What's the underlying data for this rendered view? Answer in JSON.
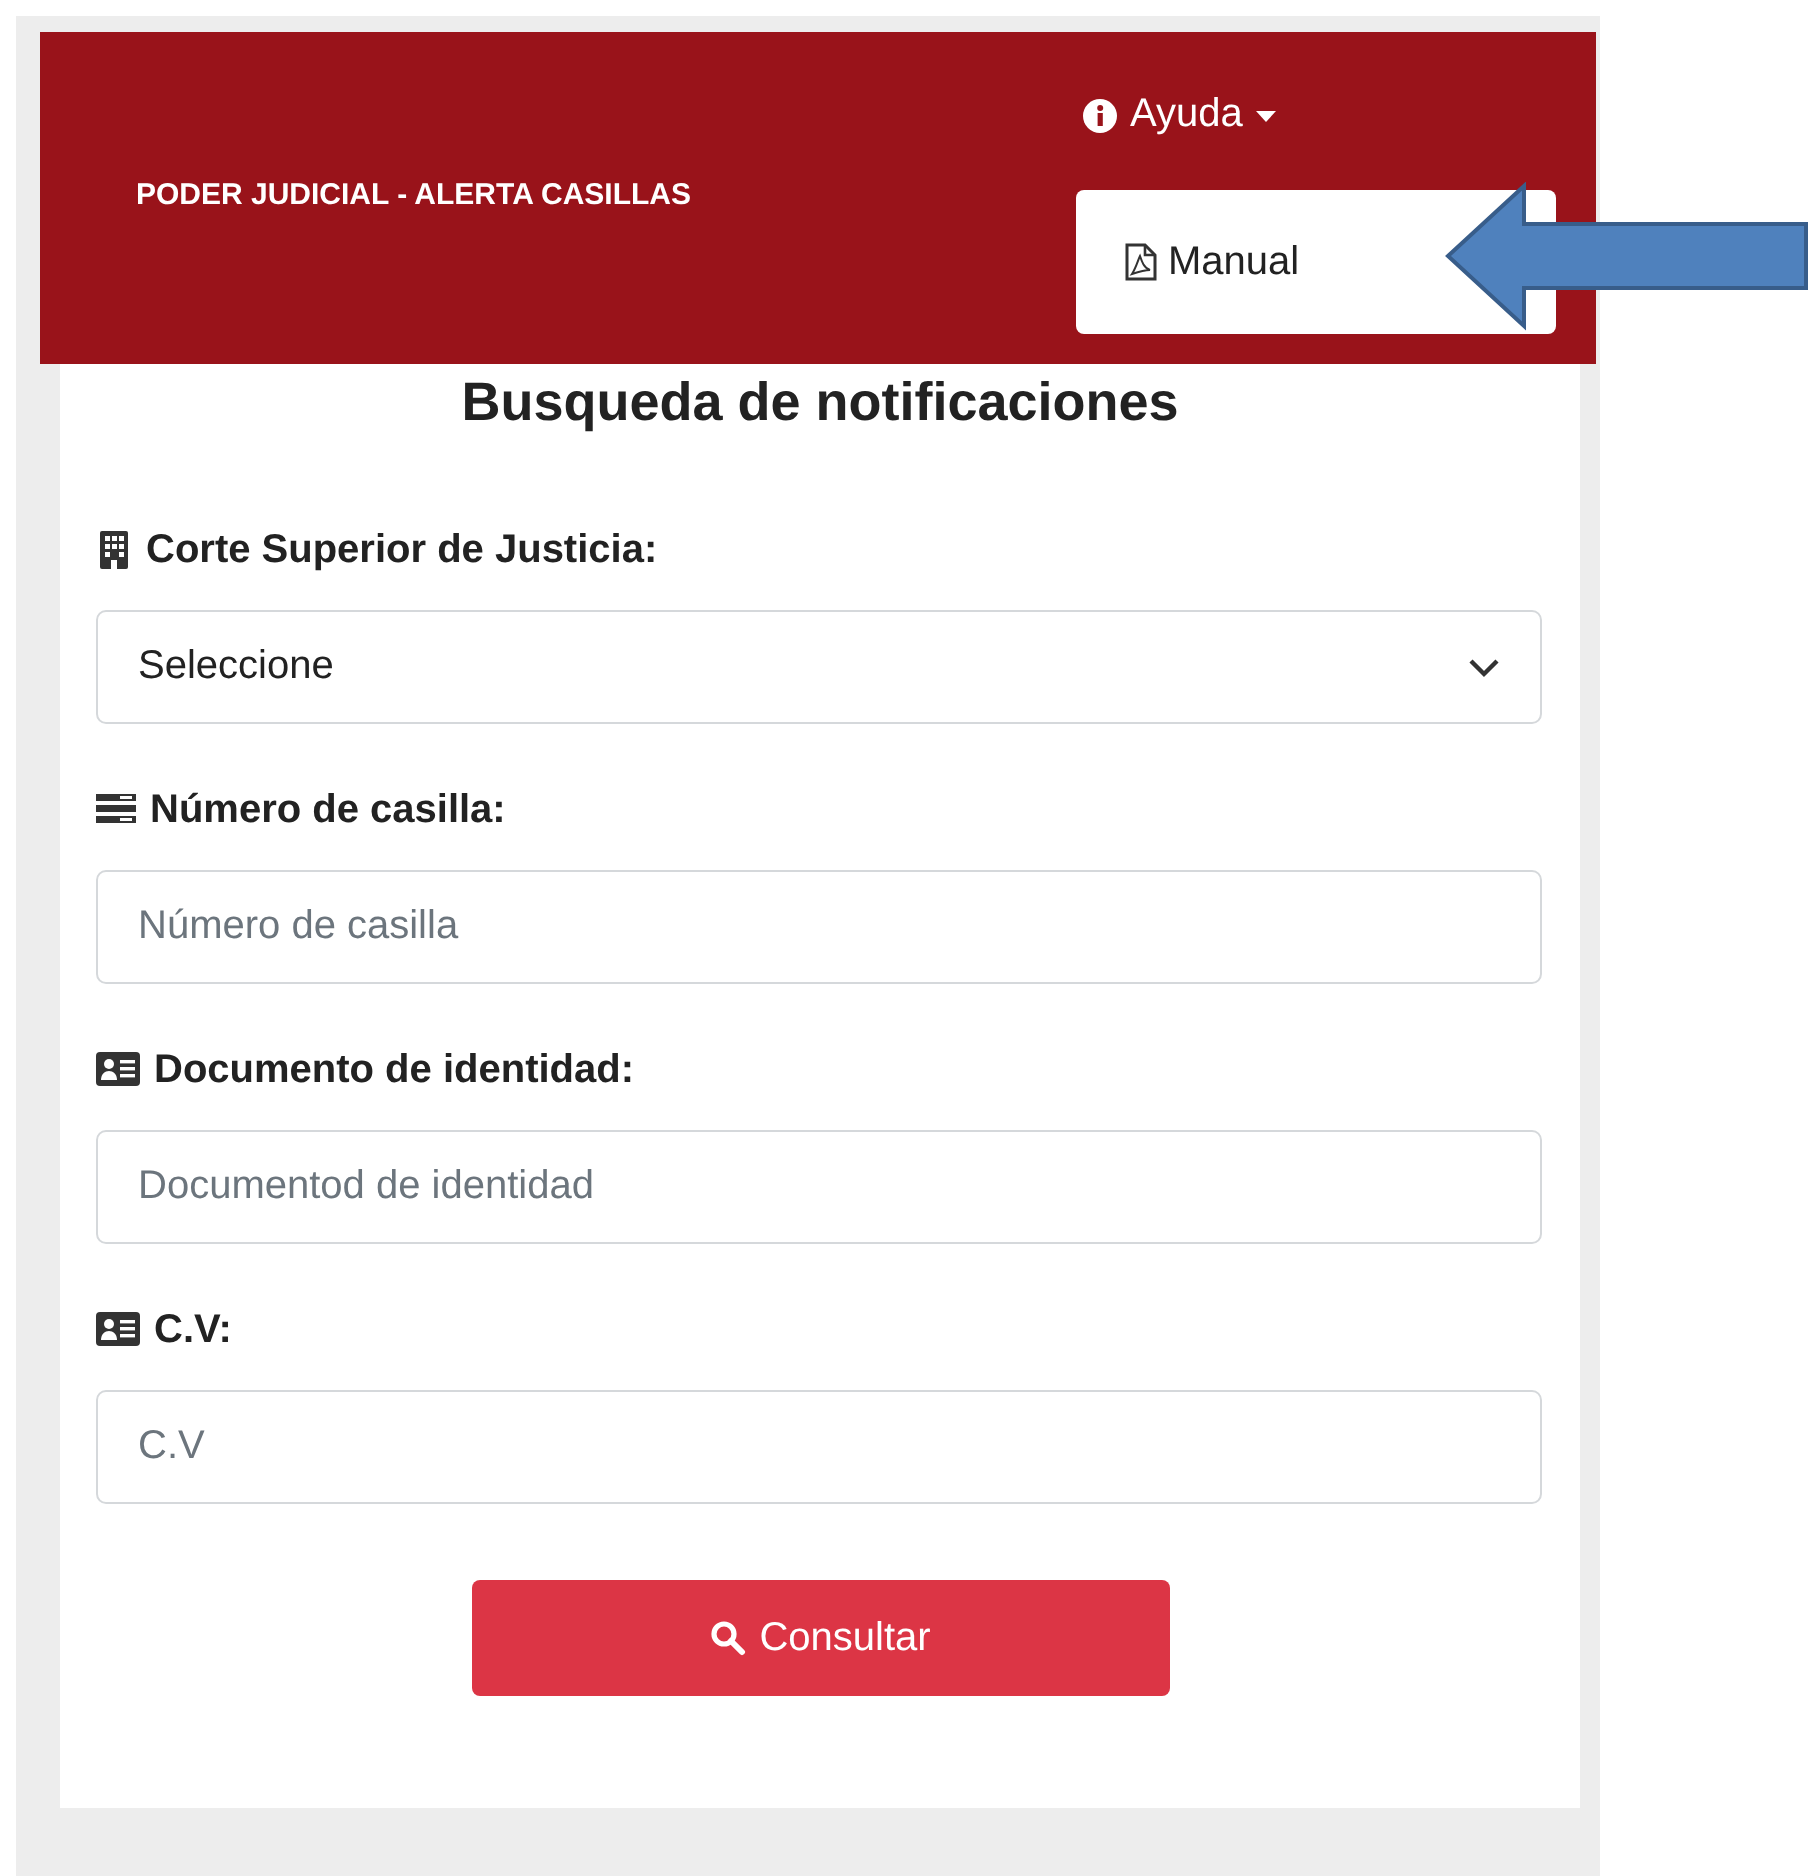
{
  "header": {
    "title": "PODER JUDICIAL - ALERTA CASILLAS",
    "help_menu": {
      "label": "Ayuda",
      "expanded": true,
      "items": [
        {
          "label": "Manual"
        }
      ]
    }
  },
  "form": {
    "title": "Busqueda de notificaciones",
    "fields": [
      {
        "kind": "select",
        "label": "Corte Superior de Justicia:",
        "value": "Seleccione"
      },
      {
        "kind": "input",
        "label": "Número de casilla:",
        "placeholder": "Número de casilla"
      },
      {
        "kind": "input",
        "label": "Documento de identidad:",
        "placeholder": "Documentod de identidad"
      },
      {
        "kind": "input",
        "label": "C.V:",
        "placeholder": "C.V"
      }
    ],
    "submit": "Consultar"
  }
}
